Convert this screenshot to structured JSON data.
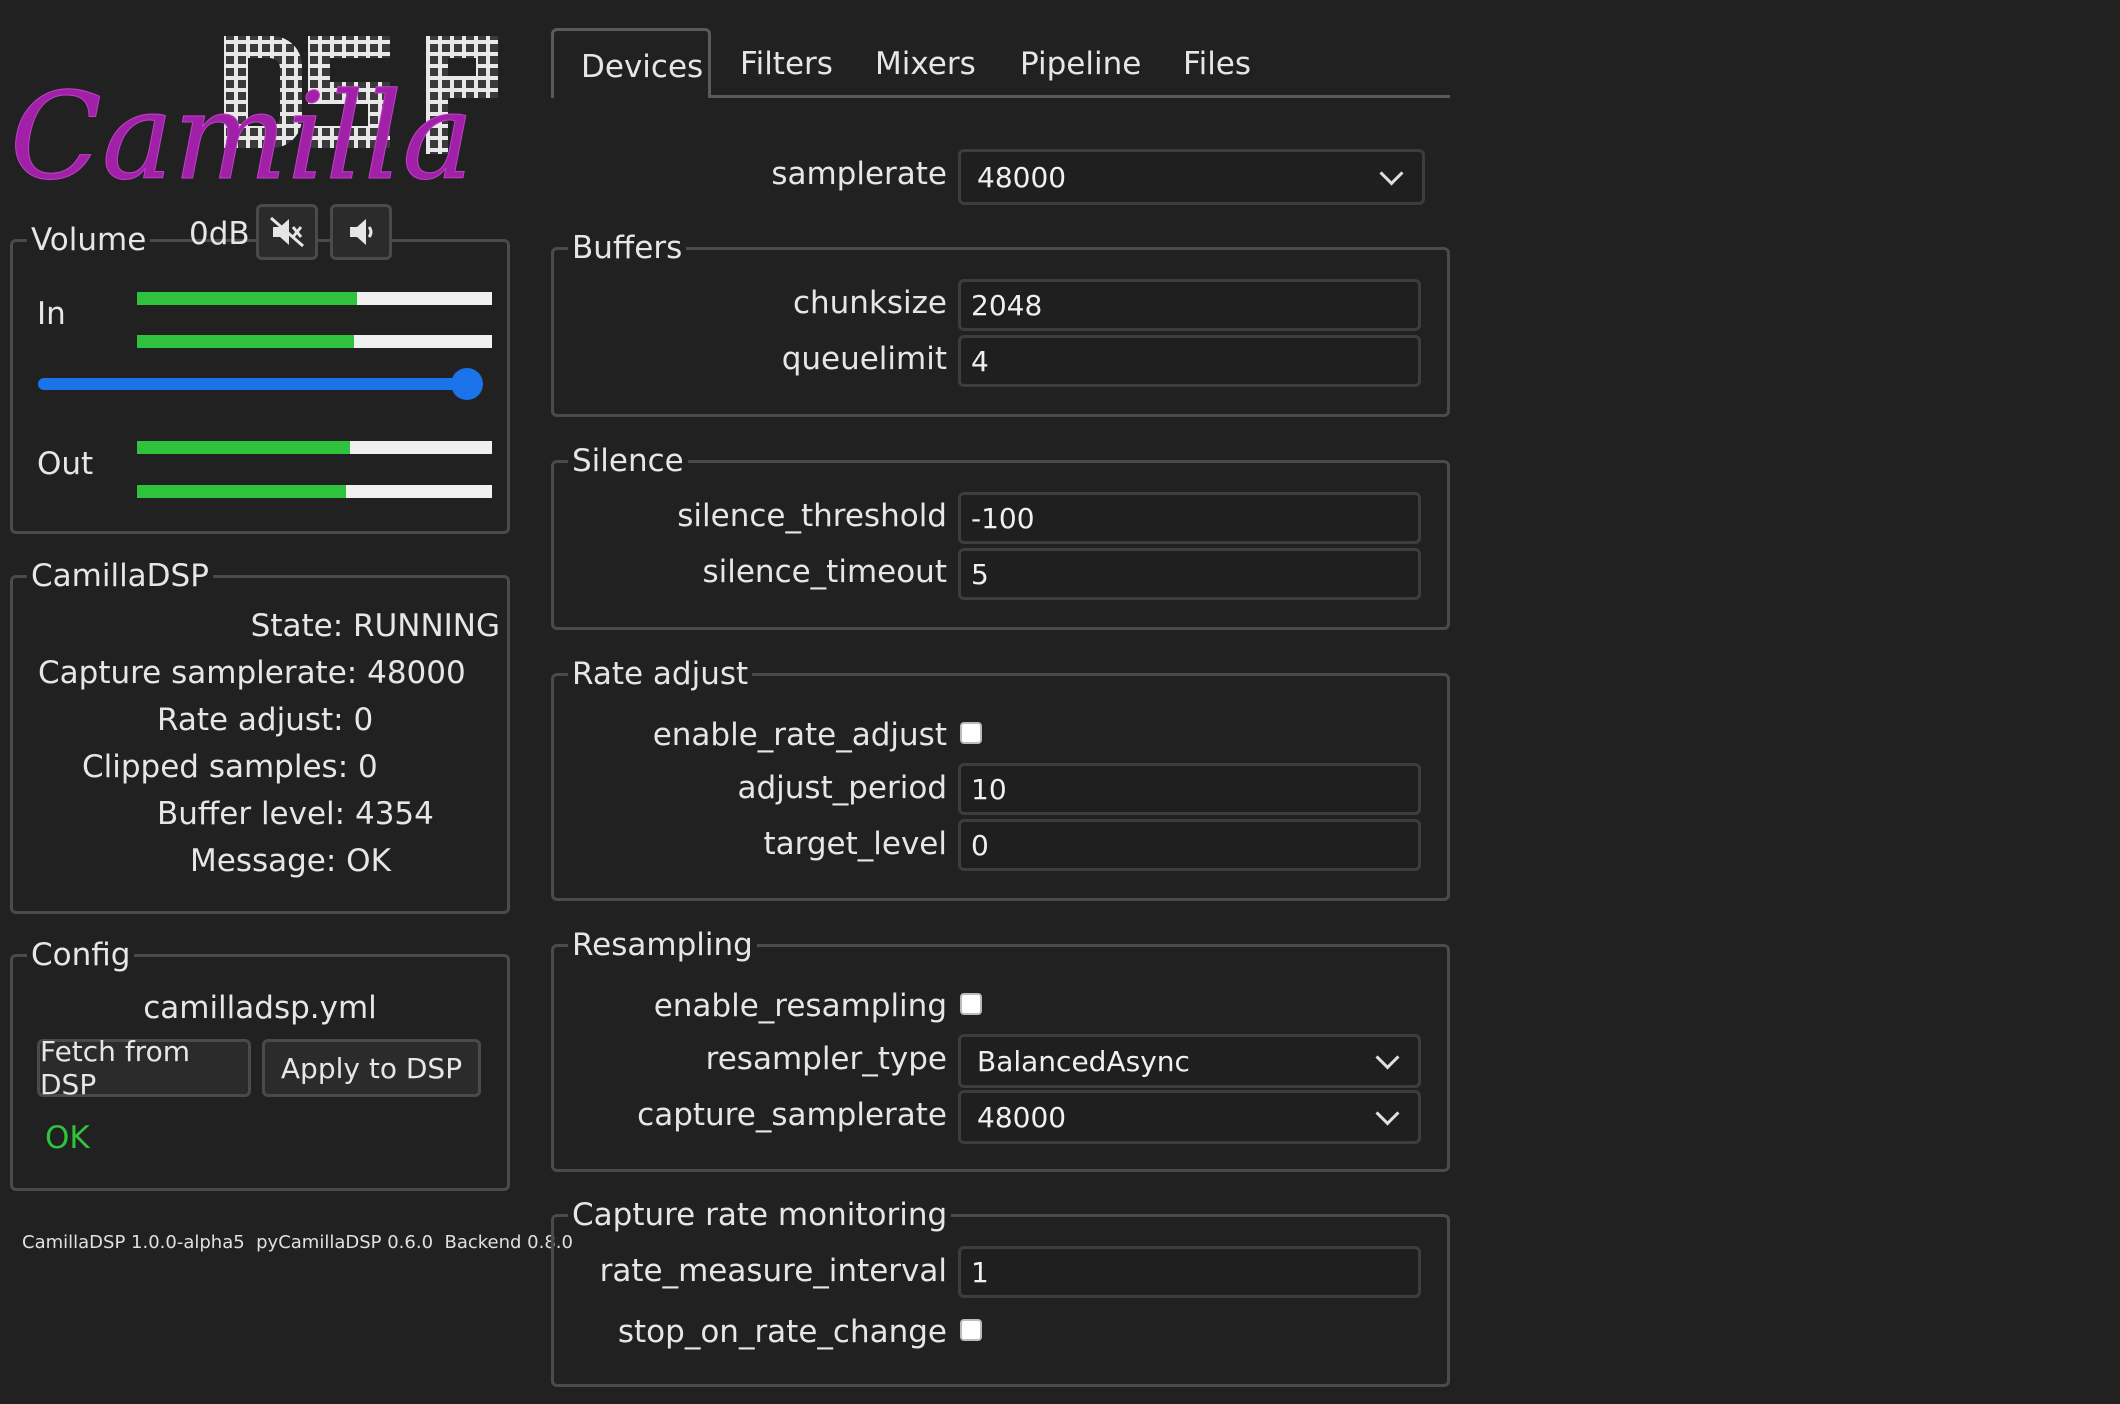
{
  "logo": {
    "script_text": "Camilla",
    "block_text": "DSP"
  },
  "volume": {
    "title": "Volume",
    "level": "0dB",
    "mute_icon": "speaker-muted-icon",
    "unmute_icon": "speaker-icon",
    "in_label": "In",
    "out_label": "Out",
    "in_levels": [
      0.62,
      0.61
    ],
    "out_levels": [
      0.6,
      0.59
    ],
    "slider_fraction": 0.97,
    "colors": {
      "meter_fill": "#2ec23d",
      "slider": "#1a73e8"
    }
  },
  "status": {
    "title": "CamillaDSP",
    "rows": [
      {
        "label": "State:",
        "value": "RUNNING"
      },
      {
        "label": "Capture samplerate:",
        "value": "48000"
      },
      {
        "label": "Rate adjust:",
        "value": "0"
      },
      {
        "label": "Clipped samples:",
        "value": "0"
      },
      {
        "label": "Buffer level:",
        "value": "4354"
      },
      {
        "label": "Message:",
        "value": "OK"
      }
    ]
  },
  "config": {
    "title": "Config",
    "filename": "camilladsp.yml",
    "fetch_label": "Fetch from DSP",
    "apply_label": "Apply to DSP",
    "status": "OK",
    "status_color": "#2ec23d"
  },
  "versions": "CamillaDSP 1.0.0-alpha5  pyCamillaDSP 0.6.0  Backend 0.8.0",
  "tabs": [
    "Devices",
    "Filters",
    "Mixers",
    "Pipeline",
    "Files"
  ],
  "active_tab": "Devices",
  "devices": {
    "samplerate": {
      "label": "samplerate",
      "value": "48000"
    },
    "buffers": {
      "title": "Buffers",
      "chunksize": {
        "label": "chunksize",
        "value": "2048"
      },
      "queuelimit": {
        "label": "queuelimit",
        "value": "4"
      }
    },
    "silence": {
      "title": "Silence",
      "threshold": {
        "label": "silence_threshold",
        "value": "-100"
      },
      "timeout": {
        "label": "silence_timeout",
        "value": "5"
      }
    },
    "rate_adjust": {
      "title": "Rate adjust",
      "enable": {
        "label": "enable_rate_adjust",
        "checked": false
      },
      "period": {
        "label": "adjust_period",
        "value": "10"
      },
      "target": {
        "label": "target_level",
        "value": "0"
      }
    },
    "resampling": {
      "title": "Resampling",
      "enable": {
        "label": "enable_resampling",
        "checked": false
      },
      "type": {
        "label": "resampler_type",
        "value": "BalancedAsync"
      },
      "capture_rate": {
        "label": "capture_samplerate",
        "value": "48000"
      }
    },
    "capture_monitor": {
      "title": "Capture rate monitoring",
      "interval": {
        "label": "rate_measure_interval",
        "value": "1"
      },
      "stop": {
        "label": "stop_on_rate_change",
        "checked": false
      }
    }
  }
}
